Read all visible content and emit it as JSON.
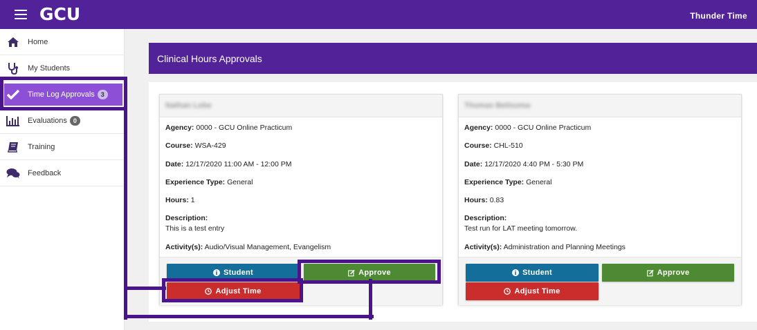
{
  "header": {
    "logo": "GCU",
    "app_title": "Thunder Time"
  },
  "sidebar": {
    "items": [
      {
        "label": "Home",
        "icon": "home-icon"
      },
      {
        "label": "My Students",
        "icon": "stethoscope-icon"
      },
      {
        "label": "Time Log Approvals",
        "icon": "check-icon",
        "badge": "3",
        "active": true
      },
      {
        "label": "Evaluations",
        "icon": "bar-chart-icon",
        "badge": "0"
      },
      {
        "label": "Training",
        "icon": "book-icon"
      },
      {
        "label": "Feedback",
        "icon": "comments-icon"
      }
    ]
  },
  "main": {
    "title": "Clinical Hours Approvals"
  },
  "cards": [
    {
      "student_name": "Nathan Lobe",
      "agency_label": "Agency:",
      "agency": "0000 - GCU Online Practicum",
      "course_label": "Course:",
      "course": "WSA-429",
      "date_label": "Date:",
      "date": "12/17/2020 11:00 AM - 12:00 PM",
      "experience_label": "Experience Type:",
      "experience": "General",
      "hours_label": "Hours:",
      "hours": "1",
      "description_label": "Description:",
      "description": "This is a test entry",
      "activities_label": "Activity(s):",
      "activities": "Audio/Visual Management, Evangelism",
      "student_button": "Student",
      "approve_button": "Approve",
      "adjust_button": "Adjust Time"
    },
    {
      "student_name": "Thomas Bettsoma",
      "agency_label": "Agency:",
      "agency": "0000 - GCU Online Practicum",
      "course_label": "Course:",
      "course": "CHL-510",
      "date_label": "Date:",
      "date": "12/17/2020 4:40 PM - 5:30 PM",
      "experience_label": "Experience Type:",
      "experience": "General",
      "hours_label": "Hours:",
      "hours": "0.83",
      "description_label": "Description:",
      "description": "Test run for LAT meeting tomorrow.",
      "activities_label": "Activity(s):",
      "activities": "Administration and Planning Meetings",
      "student_button": "Student",
      "approve_button": "Approve",
      "adjust_button": "Adjust Time"
    }
  ],
  "colors": {
    "brand_purple": "#522398",
    "active_nav": "#8c4fd6",
    "student_blue": "#136f99",
    "approve_green": "#4e8a34",
    "adjust_red": "#cb2d2d",
    "highlight": "#4a148c"
  }
}
